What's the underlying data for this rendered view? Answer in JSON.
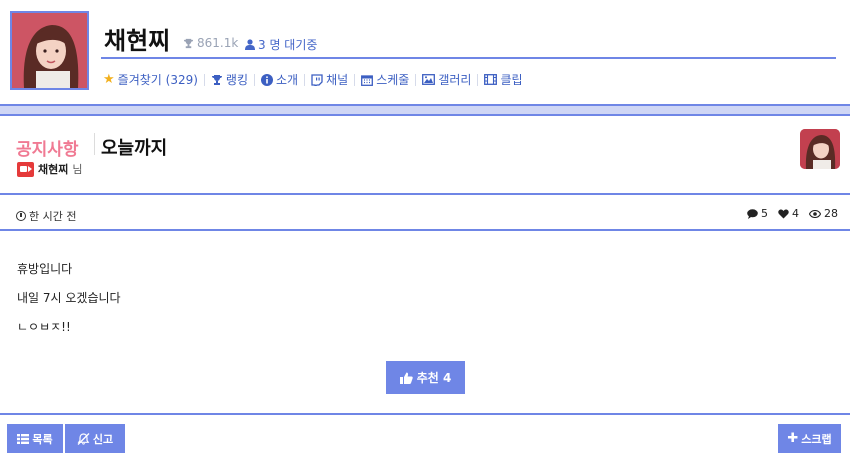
{
  "header": {
    "streamer_name": "채현찌",
    "fans": "861.1k",
    "waiting": "3 명 대기중",
    "nav": [
      {
        "icon": "star-icon",
        "label": "즐겨찾기 (329)"
      },
      {
        "icon": "trophy-icon",
        "label": "랭킹"
      },
      {
        "icon": "info-icon",
        "label": "소개"
      },
      {
        "icon": "twitch-icon",
        "label": "채널"
      },
      {
        "icon": "calendar-icon",
        "label": "스케줄"
      },
      {
        "icon": "image-icon",
        "label": "갤러리"
      },
      {
        "icon": "film-icon",
        "label": "클립"
      }
    ]
  },
  "post": {
    "category": "공지사항",
    "title": "오늘까지",
    "author": "채현찌",
    "author_suffix": "님",
    "time": "한 시간 전",
    "comments": "5",
    "likes": "4",
    "views": "28",
    "lines": [
      "휴방입니다",
      "내일 7시 오겠습니다",
      "ㄴㅇㅂㅈ!!"
    ]
  },
  "actions": {
    "recommend": "추천 4",
    "list": "목록",
    "report": "신고",
    "scrap": "스크랩"
  },
  "colors": {
    "accent": "#6f86e6",
    "category": "#f07a93",
    "nav_text": "#3c5fc2",
    "star": "#f2b01e"
  }
}
